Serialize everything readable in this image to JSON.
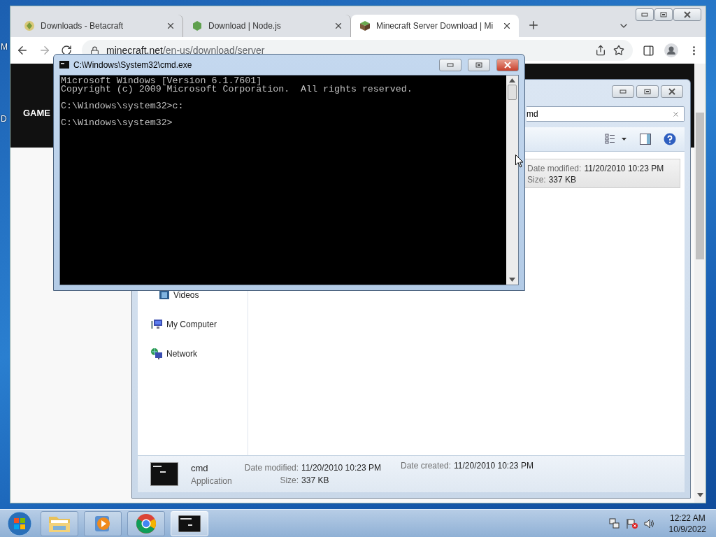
{
  "desktop": {
    "icon_labels": [
      "M",
      "D"
    ]
  },
  "browser": {
    "tabs": [
      {
        "title": "Downloads - Betacraft",
        "selected": false,
        "kind": "betacraft"
      },
      {
        "title": "Download | Node.js",
        "selected": false,
        "kind": "node"
      },
      {
        "title": "Minecraft Server Download | Mi",
        "selected": true,
        "kind": "grass"
      }
    ],
    "url_host": "minecraft.net",
    "url_path": "/en-us/download/server",
    "nav_label": "GAME"
  },
  "explorer": {
    "search_value": "md",
    "result": {
      "selected": true,
      "modified_label": "Date modified:",
      "modified": "11/20/2010 10:23 PM",
      "size_label": "Size:",
      "size": "337 KB"
    },
    "nav_items": [
      {
        "label": "Videos",
        "kind": "videos"
      },
      {
        "label": "My Computer",
        "kind": "computer"
      },
      {
        "label": "Network",
        "kind": "network"
      }
    ],
    "details": {
      "name": "cmd",
      "type": "Application",
      "modified_label": "Date modified:",
      "modified": "11/20/2010 10:23 PM",
      "size_label": "Size:",
      "size": "337 KB",
      "created_label": "Date created:",
      "created": "11/20/2010 10:23 PM"
    }
  },
  "console": {
    "title": "C:\\Windows\\System32\\cmd.exe",
    "output": "Microsoft Windows [Version 6.1.7601]\nCopyright (c) 2009 Microsoft Corporation.  All rights reserved.\n\nC:\\Windows\\system32>c:\n\nC:\\Windows\\system32>"
  },
  "taskbar": {
    "buttons": [
      {
        "kind": "explorer",
        "selected": false
      },
      {
        "kind": "media",
        "selected": false
      },
      {
        "kind": "chrome",
        "selected": false
      },
      {
        "kind": "console",
        "selected": true
      }
    ],
    "time": "12:22 AM",
    "date": "10/9/2022"
  }
}
